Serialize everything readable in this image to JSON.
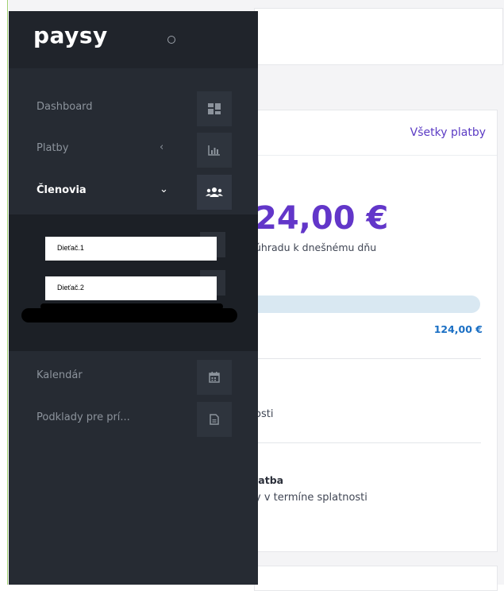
{
  "brand": {
    "logo": "paysy"
  },
  "sidebar": {
    "items": [
      {
        "label": "Dashboard",
        "icon": "dashboard-icon",
        "chevron": ""
      },
      {
        "label": "Platby",
        "icon": "chart-icon",
        "chevron": "‹"
      },
      {
        "label": "Členovia",
        "icon": "users-icon",
        "chevron": "⌄",
        "active": true
      },
      {
        "label": "Kalendár",
        "icon": "calendar-icon",
        "chevron": ""
      },
      {
        "label": "Podklady pre prí...",
        "icon": "document-icon",
        "chevron": ""
      }
    ],
    "submenu": [
      {
        "label": "Dieťač.1"
      },
      {
        "label": "Dieťač.2"
      }
    ]
  },
  "background": {
    "all_payments_link": "Všetky platby",
    "amount_big": "24,00 €",
    "amount_sub": "úhradu k dnešnému dňu",
    "amount_end": "124,00 €",
    "row1_text": "osti",
    "row2_title": "latba",
    "row2_text": "y v termíne splatnosti"
  },
  "colors": {
    "sidebar_bg": "#262b33",
    "submenu_bg": "#1c2026",
    "accent_purple": "#6236c9",
    "link_blue": "#1a6fc4"
  }
}
